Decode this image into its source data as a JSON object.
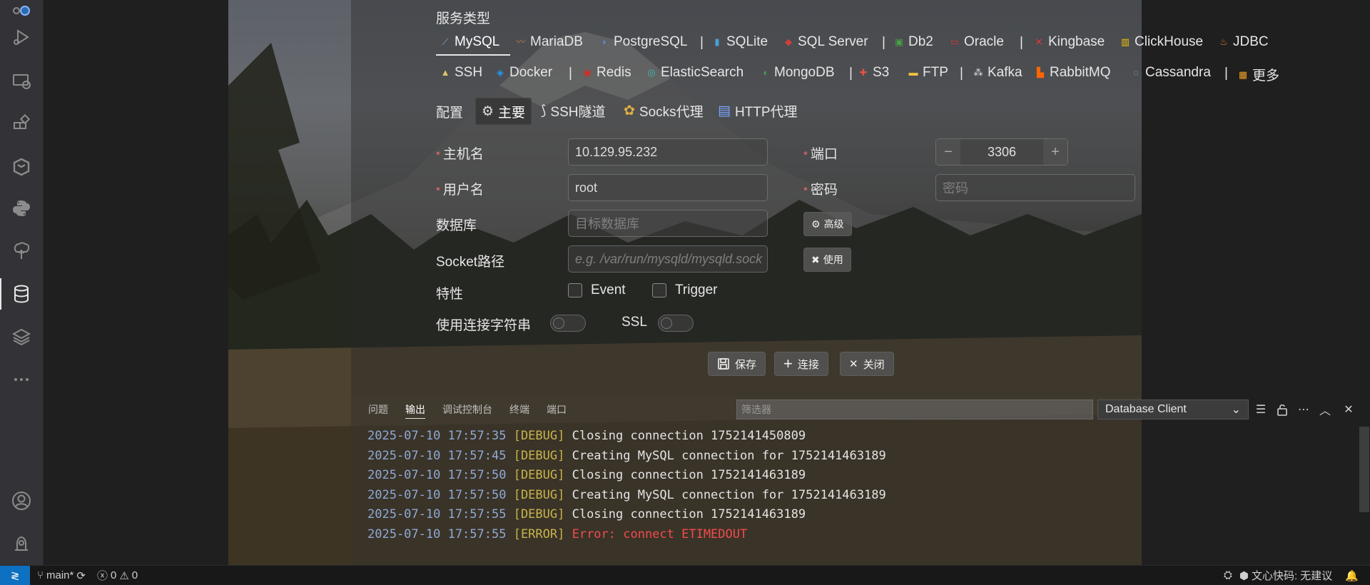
{
  "service_section": {
    "label": "服务类型",
    "row1": [
      {
        "name": "MySQL",
        "icon": "mysql-icon",
        "active": true
      },
      {
        "name": "MariaDB",
        "icon": "mariadb-icon"
      },
      {
        "name": "PostgreSQL",
        "icon": "postgresql-icon"
      },
      {
        "name": "SQLite",
        "icon": "sqlite-icon"
      },
      {
        "name": "SQL Server",
        "icon": "sqlserver-icon"
      },
      {
        "name": "Db2",
        "icon": "db2-icon"
      },
      {
        "name": "Oracle",
        "icon": "oracle-icon"
      },
      {
        "name": "Kingbase",
        "icon": "kingbase-icon"
      },
      {
        "name": "ClickHouse",
        "icon": "clickhouse-icon"
      },
      {
        "name": "JDBC",
        "icon": "jdbc-icon"
      }
    ],
    "row2": [
      {
        "name": "SSH",
        "icon": "ssh-icon"
      },
      {
        "name": "Docker",
        "icon": "docker-icon"
      },
      {
        "name": "Redis",
        "icon": "redis-icon"
      },
      {
        "name": "ElasticSearch",
        "icon": "elasticsearch-icon"
      },
      {
        "name": "MongoDB",
        "icon": "mongodb-icon"
      },
      {
        "name": "S3",
        "icon": "s3-icon"
      },
      {
        "name": "FTP",
        "icon": "folder-icon"
      },
      {
        "name": "Kafka",
        "icon": "kafka-icon"
      },
      {
        "name": "RabbitMQ",
        "icon": "rabbitmq-icon"
      },
      {
        "name": "Cassandra",
        "icon": "cassandra-icon"
      },
      {
        "name": "更多",
        "icon": "grid-icon"
      }
    ],
    "separator": "|"
  },
  "config": {
    "label": "配置",
    "tabs": [
      {
        "label": "主要",
        "icon": "gear-icon",
        "active": true
      },
      {
        "label": "SSH隧道",
        "icon": "tunnel-icon"
      },
      {
        "label": "Socks代理",
        "icon": "proxy-icon"
      },
      {
        "label": "HTTP代理",
        "icon": "http-icon"
      }
    ]
  },
  "fields": {
    "host_label": "主机名",
    "host_value": "10.129.95.232",
    "port_label": "端口",
    "port_value": "3306",
    "user_label": "用户名",
    "user_value": "root",
    "password_label": "密码",
    "password_placeholder": "密码",
    "database_label": "数据库",
    "database_placeholder": "目标数据库",
    "socket_label": "Socket路径",
    "socket_placeholder": "e.g. /var/run/mysqld/mysqld.sock",
    "advanced_label": "高级",
    "use_label": "使用",
    "feature_label": "特性",
    "event_label": "Event",
    "trigger_label": "Trigger",
    "conn_string_label": "使用连接字符串",
    "ssl_label": "SSL",
    "required_mark": "*",
    "minus": "−",
    "plus": "+"
  },
  "actions": {
    "save": "保存",
    "connect": "连接",
    "close": "关闭"
  },
  "panel": {
    "tabs": [
      "问题",
      "输出",
      "调试控制台",
      "终端",
      "端口"
    ],
    "active_tab": "输出",
    "filter_placeholder": "筛选器",
    "channel": "Database Client",
    "logs": [
      {
        "ts": "2025-07-10 17:57:35",
        "level": "[DEBUG]",
        "msg": "Closing connection 1752141450809",
        "error": false
      },
      {
        "ts": "2025-07-10 17:57:45",
        "level": "[DEBUG]",
        "msg": "Creating MySQL connection for 1752141463189",
        "error": false
      },
      {
        "ts": "2025-07-10 17:57:50",
        "level": "[DEBUG]",
        "msg": "Closing connection 1752141463189",
        "error": false
      },
      {
        "ts": "2025-07-10 17:57:50",
        "level": "[DEBUG]",
        "msg": "Creating MySQL connection for 1752141463189",
        "error": false
      },
      {
        "ts": "2025-07-10 17:57:55",
        "level": "[DEBUG]",
        "msg": "Closing connection 1752141463189",
        "error": false
      },
      {
        "ts": "2025-07-10 17:57:55",
        "level": "[ERROR]",
        "msg": "Error: connect ETIMEDOUT",
        "error": true
      }
    ]
  },
  "status_bar": {
    "branch": "main*",
    "errors": "0",
    "warnings": "0",
    "ai_status": "文心快码: 无建议"
  },
  "colors": {
    "accent": "#0e70c0",
    "error": "#f14c4c",
    "required": "#f56c6c",
    "log_level": "#c8b44a",
    "timestamp": "#8fa9d6"
  }
}
